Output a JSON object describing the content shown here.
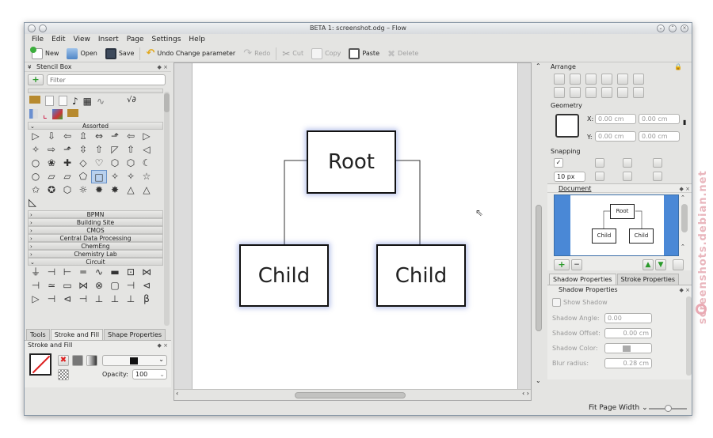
{
  "window": {
    "title": "BETA 1: screenshot.odg – Flow"
  },
  "menu": [
    "File",
    "Edit",
    "View",
    "Insert",
    "Page",
    "Settings",
    "Help"
  ],
  "toolbar": {
    "new": "New",
    "open": "Open",
    "save": "Save",
    "undo": "Undo Change parameter",
    "redo": "Redo",
    "cut": "Cut",
    "copy": "Copy",
    "paste": "Paste",
    "delete": "Delete"
  },
  "stencil_box": {
    "title": "Stencil Box",
    "filter_placeholder": "Filter",
    "assorted_label": "Assorted",
    "categories": [
      "BPMN",
      "Building Site",
      "CMOS",
      "Central Data Processing",
      "ChemEng",
      "Chemistry Lab"
    ],
    "circuit_label": "Circuit",
    "assorted_glyphs": [
      "▷",
      "⇩",
      "⇦",
      "⇫",
      "⇔",
      "⬏",
      "⇦",
      "▷",
      "✧",
      "⇨",
      "⬏",
      "⇳",
      "⇧",
      "◸",
      "⇧",
      "◁",
      "○",
      "❀",
      "✚",
      "◇",
      "♡",
      "⬡",
      "⬡",
      "☾",
      "○",
      "▱",
      "▱",
      "⬠",
      "□",
      "✧",
      "✧",
      "☆",
      "✩",
      "✪",
      "⬡",
      "☼",
      "✹",
      "✸",
      "△",
      "△"
    ],
    "circuit_glyphs": [
      "⏚",
      "⊣",
      "⊢",
      "═",
      "∿",
      "▬",
      "⊡",
      "⋈",
      "⊣",
      "≃",
      "▭",
      "⋈",
      "⊗",
      "▢",
      "⊣",
      "⊲",
      "▷",
      "⊣",
      "⊲",
      "⊣",
      "⊥",
      "⊥",
      "⊥",
      "β"
    ]
  },
  "left_tabs": [
    "Tools",
    "Stroke and Fill",
    "Shape Properties"
  ],
  "stroke_fill": {
    "title": "Stroke and Fill",
    "opacity_label": "Opacity:",
    "opacity_value": "100"
  },
  "diagram": {
    "root": "Root",
    "child_left": "Child",
    "child_right": "Child"
  },
  "arrange": {
    "title": "Arrange"
  },
  "geometry": {
    "title": "Geometry",
    "x_label": "X:",
    "y_label": "Y:",
    "x_value": "0.00 cm",
    "x_value2": "0.00 cm",
    "y_value": "0.00 cm",
    "y_value2": "0.00 cm"
  },
  "snapping": {
    "title": "Snapping",
    "distance": "10 px"
  },
  "document": {
    "title": "Document",
    "root": "Root",
    "child_left": "Child",
    "child_right": "Child"
  },
  "right_tabs": [
    "Shadow Properties",
    "Stroke Properties"
  ],
  "shadow": {
    "title": "Shadow Properties",
    "show_label": "Show Shadow",
    "angle_label": "Shadow Angle:",
    "angle_value": "0.00",
    "offset_label": "Shadow Offset:",
    "offset_value": "0.00 cm",
    "color_label": "Shadow Color:",
    "blur_label": "Blur radius:",
    "blur_value": "0.28 cm"
  },
  "status": {
    "zoom": "Fit Page Width"
  },
  "watermark": "screenshots.debian.net"
}
